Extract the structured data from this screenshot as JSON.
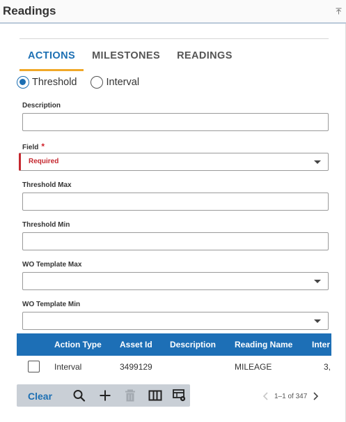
{
  "header": {
    "title": "Readings",
    "collapse_icon": "collapse-up-icon"
  },
  "tabs": [
    {
      "label": "ACTIONS",
      "active": true
    },
    {
      "label": "MILESTONES",
      "active": false
    },
    {
      "label": "READINGS",
      "active": false
    }
  ],
  "mode": {
    "options": [
      {
        "label": "Threshold",
        "checked": true
      },
      {
        "label": "Interval",
        "checked": false
      }
    ]
  },
  "form": {
    "description": {
      "label": "Description",
      "value": ""
    },
    "field": {
      "label": "Field",
      "required_marker": "*",
      "value": "Required"
    },
    "threshold_max": {
      "label": "Threshold Max",
      "value": ""
    },
    "threshold_min": {
      "label": "Threshold Min",
      "value": ""
    },
    "wo_template_max": {
      "label": "WO Template Max",
      "value": ""
    },
    "wo_template_min": {
      "label": "WO Template Min",
      "value": ""
    }
  },
  "grid": {
    "columns": [
      "Action Type",
      "Asset Id",
      "Description",
      "Reading Name",
      "Inter"
    ],
    "rows": [
      {
        "action_type": "Interval",
        "asset_id": "3499129",
        "description": "",
        "reading_name": "MILEAGE",
        "interval": "3,"
      }
    ]
  },
  "toolbar": {
    "clear_label": "Clear",
    "icons": [
      "search-icon",
      "add-icon",
      "delete-icon",
      "columns-icon",
      "grid-settings-icon"
    ]
  },
  "pager": {
    "text": "1–1 of 347"
  },
  "colors": {
    "accent": "#1c6fb3",
    "tab_underline": "#f0a828",
    "grid_header": "#1d6fb6",
    "required": "#c5282f",
    "toolbar_bg": "#c9cfd6"
  }
}
